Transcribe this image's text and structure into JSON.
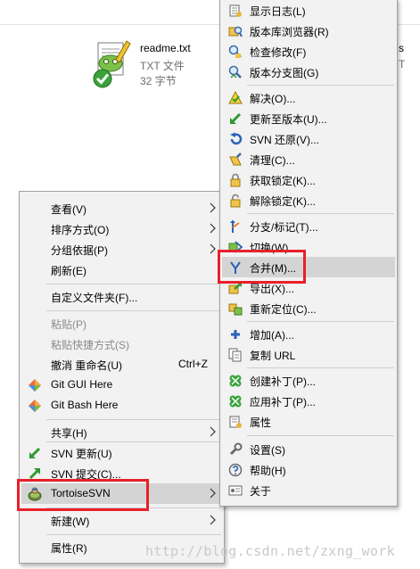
{
  "file": {
    "name": "readme.txt",
    "type": "TXT 文件",
    "size": "32 字节",
    "right_name": "s",
    "right_type": "T"
  },
  "left_menu": {
    "view": "查看(V)",
    "sort": "排序方式(O)",
    "group": "分组依据(P)",
    "refresh": "刷新(E)",
    "customize": "自定义文件夹(F)...",
    "paste": "粘贴(P)",
    "paste_shortcut": "粘贴快捷方式(S)",
    "undo": "撤消 重命名(U)",
    "undo_shortcut": "Ctrl+Z",
    "git_gui": "Git GUI Here",
    "git_bash": "Git Bash Here",
    "share": "共享(H)",
    "svn_update": "SVN 更新(U)",
    "svn_commit": "SVN 提交(C)...",
    "tortoise": "TortoiseSVN",
    "new": "新建(W)",
    "properties": "属性(R)"
  },
  "right_menu": {
    "show_log": "显示日志(L)",
    "repo_browser": "版本库浏览器(R)",
    "check_mods": "检查修改(F)",
    "revision_graph": "版本分支图(G)",
    "resolve": "解决(O)...",
    "update_to_rev": "更新至版本(U)...",
    "revert": "SVN 还原(V)...",
    "cleanup": "清理(C)...",
    "get_lock": "获取锁定(K)...",
    "release_lock": "解除锁定(K)...",
    "branch_tag": "分支/标记(T)...",
    "switch": "切换(W)...",
    "merge": "合并(M)...",
    "export": "导出(X)...",
    "relocate": "重新定位(C)...",
    "add": "增加(A)...",
    "copy_url": "复制 URL",
    "create_patch": "创建补丁(P)...",
    "apply_patch": "应用补丁(P)...",
    "properties": "属性",
    "settings": "设置(S)",
    "help": "帮助(H)",
    "about": "关于"
  },
  "watermark": "http://blog.csdn.net/zxng_work",
  "colors": {
    "menu_bg": "#f2f2f2",
    "highlight": "#d4d4d4",
    "annotation_red": "#e8202a",
    "disabled_text": "#8a8a8a"
  }
}
